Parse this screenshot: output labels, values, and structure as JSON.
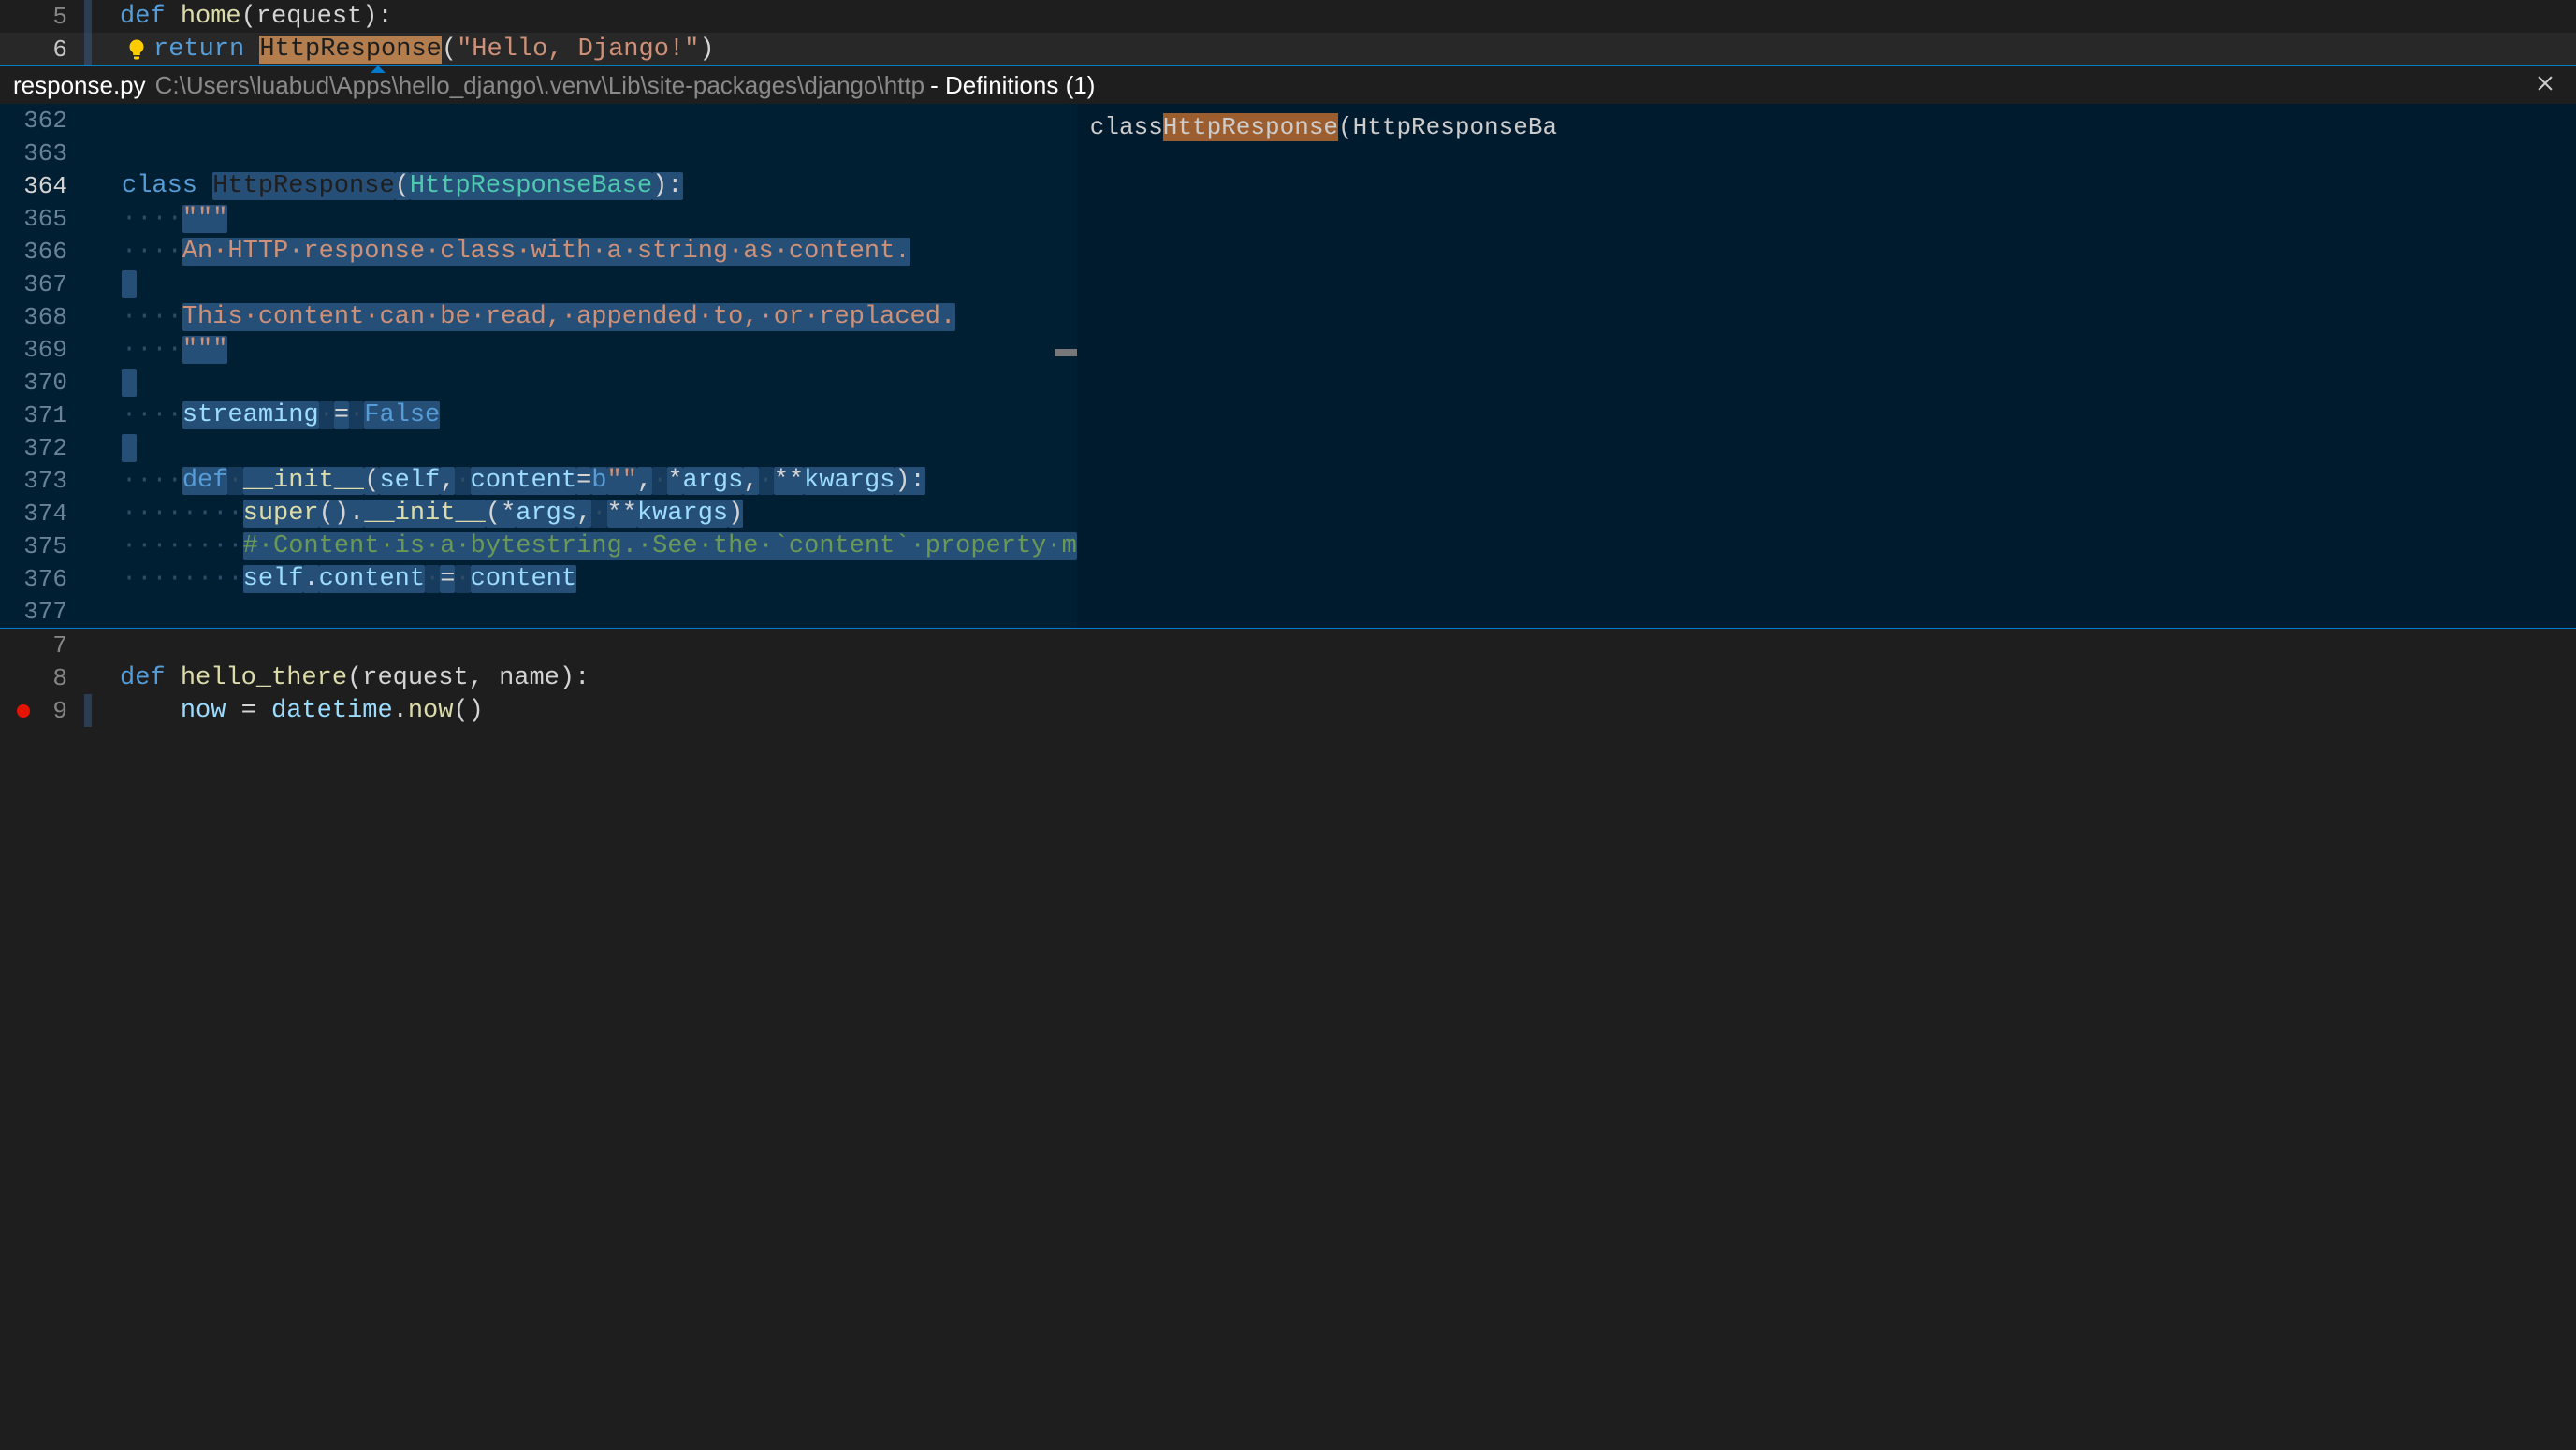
{
  "main_editor": {
    "lines": [
      {
        "num": "5",
        "code": {
          "def": "def",
          "fn": "home",
          "params": "(request)",
          "colon": ":"
        }
      },
      {
        "num": "6",
        "code": {
          "return": "return",
          "cls": "HttpResponse",
          "call": "(",
          "str": "\"Hello, Django!\"",
          "end": ")"
        }
      }
    ],
    "bottom_lines": [
      {
        "num": "7",
        "code": ""
      },
      {
        "num": "8",
        "code": {
          "def": "def",
          "fn": "hello_there",
          "params": "(request, name)",
          "colon": ":"
        }
      },
      {
        "num": "9",
        "code": {
          "var": "now",
          "eq": " = ",
          "obj": "datetime",
          "dot": ".",
          "method": "now",
          "call": "()"
        }
      }
    ]
  },
  "peek": {
    "filename": "response.py",
    "path": "C:\\Users\\luabud\\Apps\\hello_django\\.venv\\Lib\\site-packages\\django\\http",
    "def_label": " - Definitions (1)",
    "close": "×",
    "reference": {
      "prefix": "class ",
      "highlight": "HttpResponse",
      "suffix": "(HttpResponseBa"
    },
    "code_lines": [
      {
        "num": "362",
        "content": []
      },
      {
        "num": "363",
        "content": []
      },
      {
        "num": "364",
        "active": true,
        "content": [
          {
            "t": "class",
            "cls": "kw"
          },
          {
            "t": " "
          },
          {
            "t": "HttpResponse",
            "cls": "cls highlight-name selection"
          },
          {
            "t": "(",
            "cls": "selection"
          },
          {
            "t": "HttpResponseBase",
            "cls": "cls selection"
          },
          {
            "t": "):",
            "cls": "selection"
          }
        ]
      },
      {
        "num": "365",
        "content": [
          {
            "t": "····",
            "cls": "dot-ws"
          },
          {
            "t": "\"\"\"",
            "cls": "str selection"
          }
        ]
      },
      {
        "num": "366",
        "content": [
          {
            "t": "····",
            "cls": "dot-ws"
          },
          {
            "t": "An·HTTP·response·class·with·a·string·as·content.",
            "cls": "str selection",
            "dots": true
          }
        ]
      },
      {
        "num": "367",
        "content": [
          {
            "t": " ",
            "cls": "selection"
          }
        ]
      },
      {
        "num": "368",
        "content": [
          {
            "t": "····",
            "cls": "dot-ws"
          },
          {
            "t": "This·content·can·be·read,·appended·to,·or·replaced.",
            "cls": "str selection",
            "dots": true
          }
        ]
      },
      {
        "num": "369",
        "content": [
          {
            "t": "····",
            "cls": "dot-ws"
          },
          {
            "t": "\"\"\"",
            "cls": "str selection"
          }
        ]
      },
      {
        "num": "370",
        "content": [
          {
            "t": " ",
            "cls": "selection"
          }
        ]
      },
      {
        "num": "371",
        "content": [
          {
            "t": "····",
            "cls": "dot-ws"
          },
          {
            "t": "streaming",
            "cls": "prop selection"
          },
          {
            "t": "·",
            "cls": "dot-ws selection"
          },
          {
            "t": "=",
            "cls": "selection"
          },
          {
            "t": "·",
            "cls": "dot-ws selection"
          },
          {
            "t": "False",
            "cls": "const selection"
          }
        ]
      },
      {
        "num": "372",
        "content": [
          {
            "t": " ",
            "cls": "selection"
          }
        ]
      },
      {
        "num": "373",
        "content": [
          {
            "t": "····",
            "cls": "dot-ws"
          },
          {
            "t": "def",
            "cls": "kw selection"
          },
          {
            "t": "·",
            "cls": "dot-ws selection"
          },
          {
            "t": "__init__",
            "cls": "fn selection"
          },
          {
            "t": "(",
            "cls": "selection"
          },
          {
            "t": "self",
            "cls": "self selection"
          },
          {
            "t": ",",
            "cls": "selection"
          },
          {
            "t": "·",
            "cls": "dot-ws selection"
          },
          {
            "t": "content",
            "cls": "param selection"
          },
          {
            "t": "=",
            "cls": "selection"
          },
          {
            "t": "b",
            "cls": "kw selection"
          },
          {
            "t": "\"\"",
            "cls": "str selection"
          },
          {
            "t": ",",
            "cls": "selection"
          },
          {
            "t": "·",
            "cls": "dot-ws selection"
          },
          {
            "t": "*",
            "cls": "selection"
          },
          {
            "t": "args",
            "cls": "param selection"
          },
          {
            "t": ",",
            "cls": "selection"
          },
          {
            "t": "·",
            "cls": "dot-ws selection"
          },
          {
            "t": "**",
            "cls": "selection"
          },
          {
            "t": "kwargs",
            "cls": "param selection"
          },
          {
            "t": "):",
            "cls": "selection"
          }
        ]
      },
      {
        "num": "374",
        "content": [
          {
            "t": "········",
            "cls": "dot-ws"
          },
          {
            "t": "super",
            "cls": "fn selection"
          },
          {
            "t": "().",
            "cls": "selection"
          },
          {
            "t": "__init__",
            "cls": "fn selection"
          },
          {
            "t": "(*",
            "cls": "selection"
          },
          {
            "t": "args",
            "cls": "param selection"
          },
          {
            "t": ",",
            "cls": "selection"
          },
          {
            "t": "·",
            "cls": "dot-ws selection"
          },
          {
            "t": "**",
            "cls": "selection"
          },
          {
            "t": "kwargs",
            "cls": "param selection"
          },
          {
            "t": ")",
            "cls": "selection"
          }
        ]
      },
      {
        "num": "375",
        "content": [
          {
            "t": "········",
            "cls": "dot-ws"
          },
          {
            "t": "#·Content·is·a·bytestring.·See·the·`content`·property·m",
            "cls": "comment selection",
            "dots": true
          }
        ]
      },
      {
        "num": "376",
        "content": [
          {
            "t": "········",
            "cls": "dot-ws"
          },
          {
            "t": "self",
            "cls": "self selection"
          },
          {
            "t": ".",
            "cls": "selection"
          },
          {
            "t": "content",
            "cls": "prop selection"
          },
          {
            "t": "·",
            "cls": "dot-ws selection"
          },
          {
            "t": "=",
            "cls": "selection"
          },
          {
            "t": "·",
            "cls": "dot-ws selection"
          },
          {
            "t": "content",
            "cls": "prop selection"
          }
        ]
      },
      {
        "num": "377",
        "content": []
      }
    ]
  }
}
